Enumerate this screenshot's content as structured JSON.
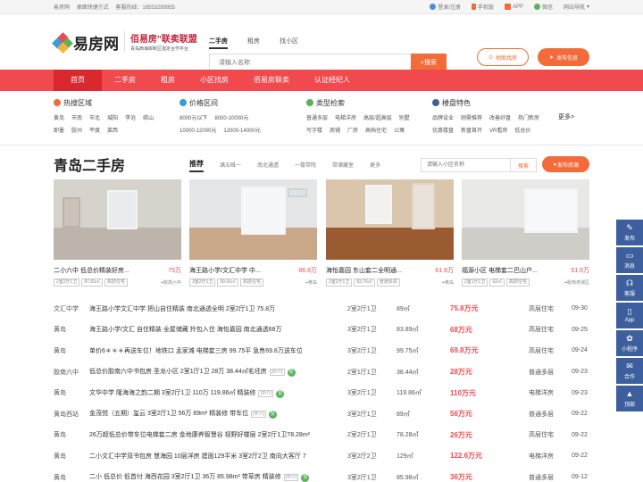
{
  "topbar": {
    "site": "易房网",
    "quick": "桌面快捷方式",
    "hotline": "客服热线：18553289955",
    "login": "登录/注册",
    "mobile": "手机版",
    "app": "APP",
    "wechat": "微信",
    "sitenav": "网站导航"
  },
  "header": {
    "logo": "易房网",
    "partner_title": "佰易房\"联卖联盟",
    "partner_sub": "青岛西海岸新区指定合作平台",
    "tabs": [
      "二手房",
      "租房",
      "找小区"
    ],
    "search_placeholder": "请输入名称",
    "search_btn": "搜索",
    "map_btn": "地图找房",
    "publish_btn": "发布信息"
  },
  "nav": [
    "首页",
    "二手房",
    "租房",
    "小区找房",
    "佰易房联卖",
    "认证经纪人"
  ],
  "filters": {
    "areas": {
      "title": "热搜区域",
      "row1": [
        "黄岛",
        "市南",
        "市北",
        "城阳",
        "李沧",
        "崂山"
      ],
      "row2": [
        "即墨",
        "胶州",
        "平度",
        "莱西"
      ]
    },
    "prices": {
      "title": "价格区间",
      "row1": [
        "8000元以下",
        "8000-10000元"
      ],
      "row2": [
        "10000-12000元",
        "12000-14000元"
      ]
    },
    "types": {
      "title": "类型检索",
      "row1": [
        "普通多层",
        "电梯洋房",
        "高层/超高层",
        "别墅"
      ],
      "row2": [
        "写字楼",
        "商铺",
        "厂房",
        "高档住宅",
        "公寓"
      ]
    },
    "features": {
      "title": "楼盘特色",
      "row1": [
        "品牌设业",
        "刚需推荐",
        "改善好盘",
        "热门新房"
      ],
      "row2": [
        "优惠楼盘",
        "新盘首开",
        "VR看房",
        "低总价"
      ]
    },
    "more": "更多>"
  },
  "section": {
    "title": "青岛二手房",
    "tabs": [
      "推荐",
      "满五唯一",
      "南北通透",
      "一楼带院",
      "带储藏室",
      "更多"
    ],
    "search_placeholder": "请输入小区名称",
    "search_btn": "搜索",
    "publish": "发布房源"
  },
  "cards": [
    {
      "title": "二小六中 低总价精装好房...",
      "price": "75万",
      "tags": [
        "2室2厅1卫",
        "87.83㎡",
        "高层住宅"
      ],
      "loc": "胶高六中"
    },
    {
      "title": "海王路小学/文汇中学 中...",
      "price": "86.8万",
      "tags": [
        "3室2厅1卫",
        "99.06㎡",
        "高层住宅"
      ],
      "loc": "黄岛"
    },
    {
      "title": "海怡嘉园 东山套二全明通...",
      "price": "61.8万",
      "tags": [
        "2室2厅1卫",
        "83.76㎡",
        "普通多层"
      ],
      "loc": "黄岛"
    },
    {
      "title": "福源小区 电梯套二巴山户...",
      "price": "51.6万",
      "tags": [
        "2室1厅1卫",
        "92㎡",
        "高层住宅"
      ],
      "loc": "胶南老城区"
    }
  ],
  "rows": [
    {
      "area": "文汇中学",
      "title": "海王路小学文汇中学 把山自住精装 南北通透全明 2室2厅1卫 75.8万",
      "badge": "",
      "zan": "",
      "layout": "2室2厅1卫",
      "size": "89㎡",
      "price": "75.8万元",
      "type": "高层住宅",
      "date": "09-30"
    },
    {
      "area": "黄岛",
      "title": "海王路小学/文汇 自住精装 全屋储藏 拎包入住 海怡嘉园 南北通透68万",
      "badge": "",
      "zan": "",
      "layout": "3室2厅1卫",
      "size": "83.89㎡",
      "price": "68万元",
      "type": "高层住宅",
      "date": "09-25"
    },
    {
      "area": "黄岛",
      "title": "单价6＊＊＊再送车位！地铁口 孟家滩 电梯套三房 99.75平 急售69.8万送车位",
      "badge": "",
      "zan": "",
      "layout": "3室2厅1卫",
      "size": "99.75㎡",
      "price": "69.8万元",
      "type": "高层住宅",
      "date": "09-24"
    },
    {
      "area": "胶南六中",
      "title": "低总价胶南六中书包房 圣龙小区 2室1厅1卫 28万 38.44㎡毛坯房",
      "badge": "[中介]",
      "zan": "赞",
      "layout": "2室1厅1卫",
      "size": "38.44㎡",
      "price": "28万元",
      "type": "普通多层",
      "date": "09-23"
    },
    {
      "area": "黄岛",
      "title": "文华中学 隆海海之韵二期 3室2厅1卫 110万 119.86㎡ 精装修",
      "badge": "[中介]",
      "zan": "赞",
      "layout": "3室2厅1卫",
      "size": "119.86㎡",
      "price": "110万元",
      "type": "电梯洋房",
      "date": "09-23"
    },
    {
      "area": "黄岛西站",
      "title": "金茂悦（五期）玺云 3室2厅1卫 56万 89m² 精装修 带车位",
      "badge": "[中介]",
      "zan": "赞",
      "layout": "3室2厅1卫",
      "size": "89㎡",
      "price": "56万元",
      "type": "普通多层",
      "date": "09-22"
    },
    {
      "area": "黄岛",
      "title": "26万超低总价带车位电梯套二房 金地康养智慧谷 视野好楼层 2室2厅1卫78.28m²",
      "badge": "",
      "zan": "",
      "layout": "2室2厅1卫",
      "size": "78.28㎡",
      "price": "26万元",
      "type": "高层住宅",
      "date": "09-22"
    },
    {
      "area": "黄岛",
      "title": "二小文汇中学双书包房 慧海园 10层洋房 建面129平米 3室2厅2卫 南向大客厅 7",
      "badge": "",
      "zan": "",
      "layout": "3室2厅2卫",
      "size": "129㎡",
      "price": "122.6万元",
      "type": "电梯洋房",
      "date": "09-22"
    },
    {
      "area": "黄岛",
      "title": "二小 低总价 低首付 海西花园 3室2厅1卫 36万 85.98m² 带草房 精装修",
      "badge": "[中介]",
      "zan": "赞",
      "layout": "3室2厅1卫",
      "size": "85.98㎡",
      "price": "36万元",
      "type": "普通多层",
      "date": "09-12"
    }
  ],
  "sidebar": [
    "发布",
    "消息",
    "客服",
    "App",
    "小程序",
    "合作",
    "顶部"
  ],
  "colors": {
    "accent": "#f26b39",
    "nav": "#f04a4f",
    "sidebar": "#3e5f9e"
  }
}
